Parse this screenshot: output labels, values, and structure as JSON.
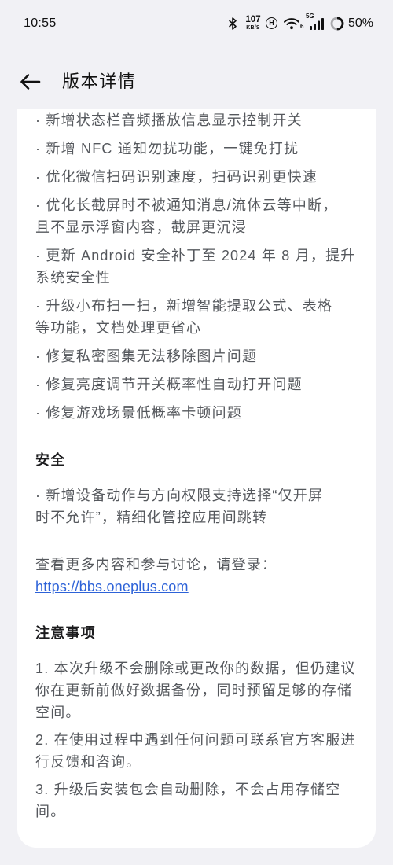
{
  "status_bar": {
    "time": "10:55",
    "net_speed_value": "107",
    "net_speed_unit": "KB/S",
    "hd_badge": "H",
    "wifi_standard": "6",
    "network_type": "5G",
    "battery_percent": "50%",
    "battery_level": 0.5,
    "icons": [
      "bluetooth-icon",
      "hd-icon",
      "wifi-icon",
      "signal-icon",
      "battery-icon"
    ]
  },
  "header": {
    "back_icon": "arrow-left-icon",
    "title": "版本详情"
  },
  "colors": {
    "background": "#f1f1f5",
    "card": "#ffffff",
    "divider": "#dcdce0",
    "text_primary": "#1c1c1e",
    "text_secondary": "#55585d",
    "link": "#2d62d8"
  },
  "updates": {
    "items": [
      {
        "lines": [
          "· 新增状态栏音频播放信息显示控制开关"
        ]
      },
      {
        "lines": [
          "· 新增 NFC 通知勿扰功能，一键免打扰"
        ]
      },
      {
        "lines": [
          "· 优化微信扫码识别速度，扫码识别更快速"
        ]
      },
      {
        "lines": [
          "· 优化长截屏时不被通知消息/流体云等中断，",
          "且不显示浮窗内容，截屏更沉浸"
        ]
      },
      {
        "lines": [
          "· 更新 Android 安全补丁至 2024 年 8 月，提升",
          "系统安全性"
        ]
      },
      {
        "lines": [
          "· 升级小布扫一扫，新增智能提取公式、表格",
          "等功能，文档处理更省心"
        ]
      },
      {
        "lines": [
          "· 修复私密图集无法移除图片问题"
        ]
      },
      {
        "lines": [
          "· 修复亮度调节开关概率性自动打开问题"
        ]
      },
      {
        "lines": [
          "· 修复游戏场景低概率卡顿问题"
        ]
      }
    ]
  },
  "security": {
    "heading": "安全",
    "items": [
      {
        "lines": [
          "· 新增设备动作与方向权限支持选择“仅开屏",
          "时不允许”，精细化管控应用间跳转"
        ]
      }
    ]
  },
  "more_info": {
    "text": "查看更多内容和参与讨论，请登录：",
    "link_text": "https://bbs.oneplus.com"
  },
  "notes": {
    "heading": "注意事项",
    "items": [
      {
        "lines": [
          "1. 本次升级不会删除或更改你的数据，但仍建议",
          "你在更新前做好数据备份，同时预留足够的存储",
          "空间。"
        ]
      },
      {
        "lines": [
          "2. 在使用过程中遇到任何问题可联系官方客服进",
          "行反馈和咨询。"
        ]
      },
      {
        "lines": [
          "3. 升级后安装包会自动删除，不会占用存储空",
          "间。"
        ]
      }
    ]
  }
}
